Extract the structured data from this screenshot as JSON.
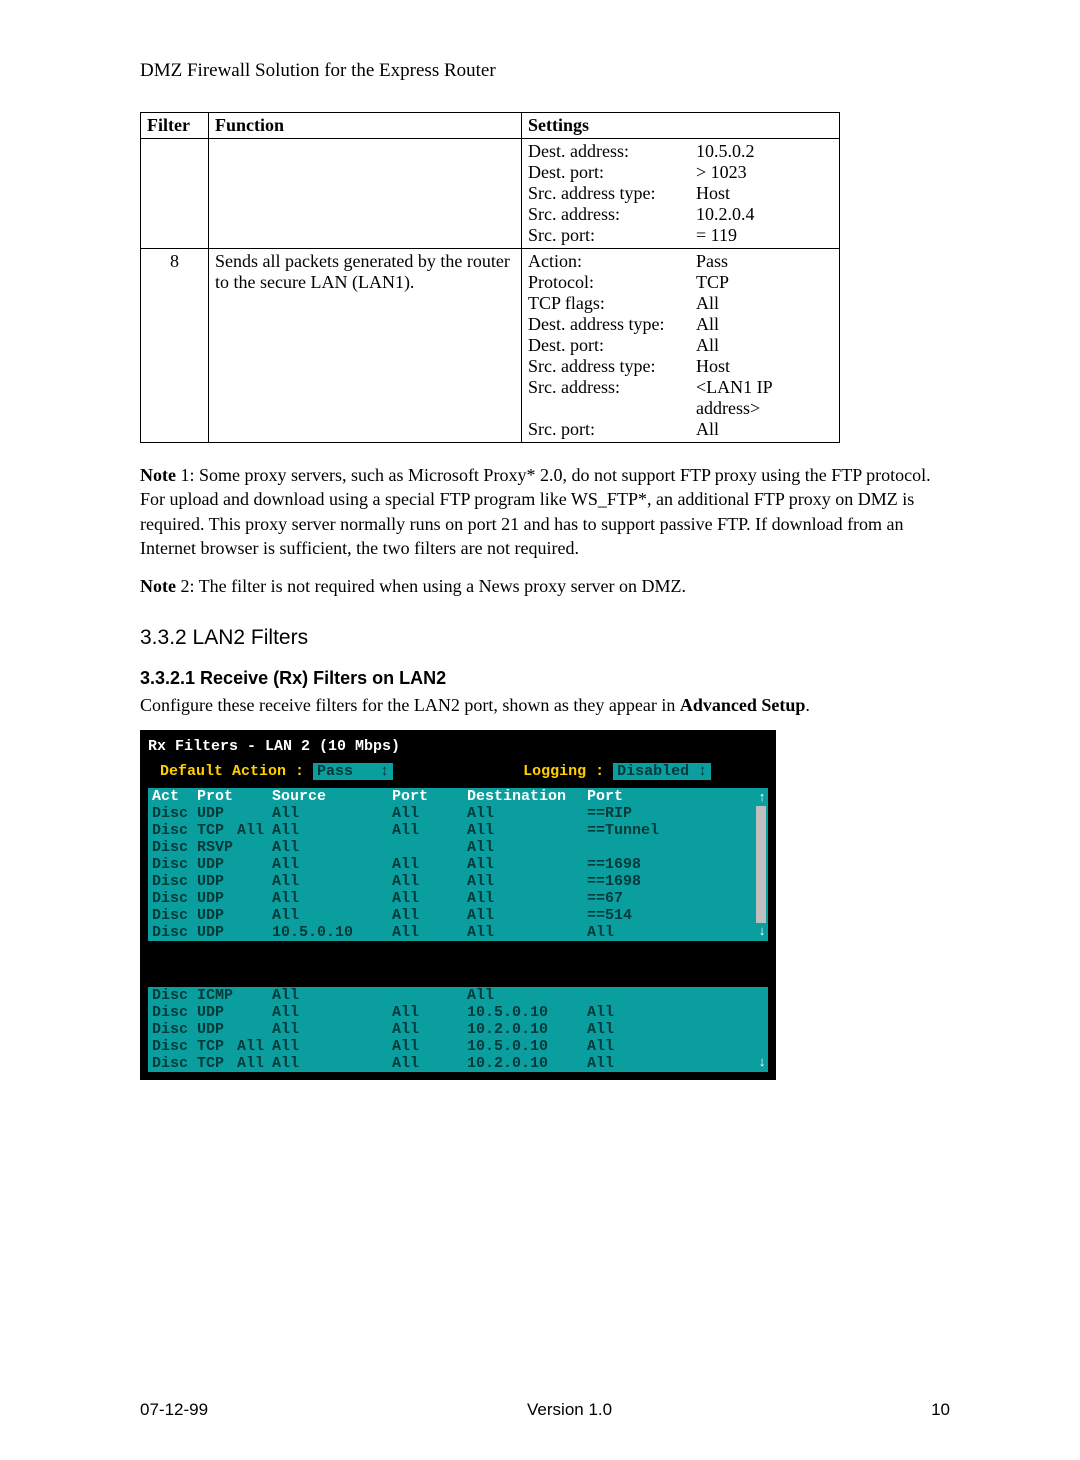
{
  "header": {
    "title": "DMZ Firewall Solution for the Express Router"
  },
  "table": {
    "headers": {
      "filter": "Filter",
      "function": "Function",
      "settings": "Settings"
    },
    "rows": [
      {
        "filter": "",
        "function": "",
        "settings": [
          [
            "Dest. address:",
            "10.5.0.2"
          ],
          [
            "Dest. port:",
            "> 1023"
          ],
          [
            "Src. address type:",
            "Host"
          ],
          [
            "Src. address:",
            "10.2.0.4"
          ],
          [
            "Src. port:",
            "= 119"
          ]
        ]
      },
      {
        "filter": "8",
        "function": "Sends all packets generated by the router to the secure LAN (LAN1).",
        "settings": [
          [
            "Action:",
            "Pass"
          ],
          [
            "Protocol:",
            "TCP"
          ],
          [
            "TCP flags:",
            "All"
          ],
          [
            "Dest. address type:",
            "All"
          ],
          [
            "Dest. port:",
            "All"
          ],
          [
            "Src. address type:",
            "Host"
          ],
          [
            "Src. address:",
            "<LAN1 IP address>"
          ],
          [
            "Src. port:",
            "All"
          ]
        ]
      }
    ]
  },
  "notes": {
    "n1_label": "Note",
    "n1_num": " 1",
    "n1_body": ": Some proxy servers, such as Microsoft Proxy* 2.0, do not support FTP proxy using the FTP protocol. For upload and download using a special FTP program like WS_FTP*, an additional FTP proxy on DMZ is required. This proxy server normally runs on port 21 and has to support passive FTP. If download from an Internet browser is sufficient, the two filters are not required.",
    "n2_label": "Note",
    "n2_num": " 2",
    "n2_body": ": The filter is not required when using a News proxy server on DMZ."
  },
  "sections": {
    "s332": "3.3.2  LAN2 Filters",
    "s3321": "3.3.2.1  Receive (Rx) Filters on LAN2",
    "intro_pre": "Configure these receive filters for the LAN2 port, shown as they appear in ",
    "intro_bold": "Advanced Setup",
    "intro_post": "."
  },
  "terminal": {
    "title": "Rx Filters - LAN 2 (10 Mbps)",
    "default_label": "Default Action :",
    "default_value": "Pass",
    "logging_label": "Logging :",
    "logging_value": "Disabled",
    "columns": {
      "act": "Act",
      "prot": "Prot",
      "flags": "",
      "source": "Source",
      "port1": "Port",
      "dest": "Destination",
      "port2": "Port"
    },
    "group1": [
      {
        "act": "Disc",
        "prot": "UDP",
        "flags": "",
        "src": "All",
        "p1": "All",
        "dst": "All",
        "p2": "==RIP"
      },
      {
        "act": "Disc",
        "prot": "TCP",
        "flags": "All",
        "src": "All",
        "p1": "All",
        "dst": "All",
        "p2": "==Tunnel"
      },
      {
        "act": "Disc",
        "prot": "RSVP",
        "flags": "",
        "src": "All",
        "p1": "",
        "dst": "All",
        "p2": ""
      },
      {
        "act": "Disc",
        "prot": "UDP",
        "flags": "",
        "src": "All",
        "p1": "All",
        "dst": "All",
        "p2": "==1698"
      },
      {
        "act": "Disc",
        "prot": "UDP",
        "flags": "",
        "src": "All",
        "p1": "All",
        "dst": "All",
        "p2": "==1698"
      },
      {
        "act": "Disc",
        "prot": "UDP",
        "flags": "",
        "src": "All",
        "p1": "All",
        "dst": "All",
        "p2": "==67"
      },
      {
        "act": "Disc",
        "prot": "UDP",
        "flags": "",
        "src": "All",
        "p1": "All",
        "dst": "All",
        "p2": "==514"
      },
      {
        "act": "Disc",
        "prot": "UDP",
        "flags": "",
        "src": "10.5.0.10",
        "p1": "All",
        "dst": "All",
        "p2": "All"
      }
    ],
    "group2": [
      {
        "act": "Disc",
        "prot": "ICMP",
        "flags": "",
        "src": "All",
        "p1": "",
        "dst": "All",
        "p2": ""
      },
      {
        "act": "Disc",
        "prot": "UDP",
        "flags": "",
        "src": "All",
        "p1": "All",
        "dst": "10.5.0.10",
        "p2": "All"
      },
      {
        "act": "Disc",
        "prot": "UDP",
        "flags": "",
        "src": "All",
        "p1": "All",
        "dst": "10.2.0.10",
        "p2": "All"
      },
      {
        "act": "Disc",
        "prot": "TCP",
        "flags": "All",
        "src": "All",
        "p1": "All",
        "dst": "10.5.0.10",
        "p2": "All"
      },
      {
        "act": "Disc",
        "prot": "TCP",
        "flags": "All",
        "src": "All",
        "p1": "All",
        "dst": "10.2.0.10",
        "p2": "All"
      }
    ]
  },
  "footer": {
    "date": "07-12-99",
    "version": "Version 1.0",
    "page": "10"
  }
}
